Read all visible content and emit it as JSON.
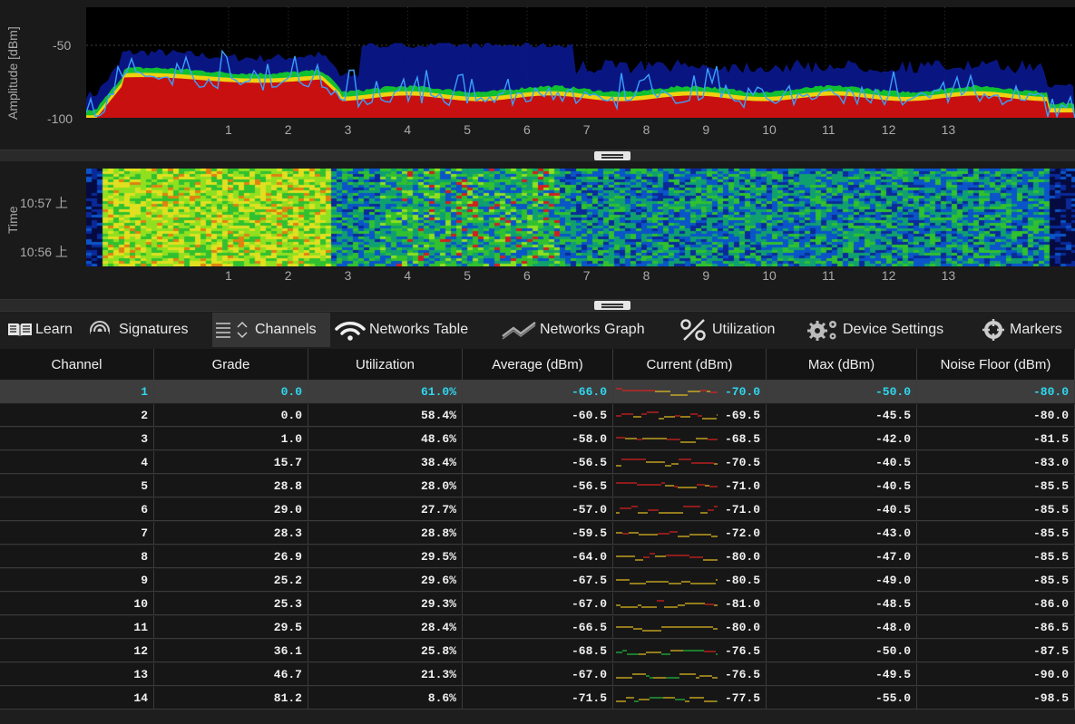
{
  "spectrum": {
    "ylabel": "Amplitude [dBm]",
    "yticks": [
      "-50",
      "-100"
    ],
    "xticks": [
      "1",
      "2",
      "3",
      "4",
      "5",
      "6",
      "7",
      "8",
      "9",
      "10",
      "11",
      "12",
      "13"
    ]
  },
  "waterfall": {
    "ylabel": "Time",
    "yticks": [
      "10:57 上",
      "10:56 上"
    ],
    "xticks": [
      "1",
      "2",
      "3",
      "4",
      "5",
      "6",
      "7",
      "8",
      "9",
      "10",
      "11",
      "12",
      "13"
    ]
  },
  "tabs": [
    {
      "label": "Learn",
      "icon": "book-icon",
      "active": false
    },
    {
      "label": "Signatures",
      "icon": "signature-icon",
      "active": false
    },
    {
      "label": "Channels",
      "icon": "channels-icon",
      "active": true
    },
    {
      "label": "Networks Table",
      "icon": "wifi-icon",
      "active": false
    },
    {
      "label": "Networks Graph",
      "icon": "graph-icon",
      "active": false
    },
    {
      "label": "Utilization",
      "icon": "percent-icon",
      "active": false
    },
    {
      "label": "Device Settings",
      "icon": "gears-icon",
      "active": false
    },
    {
      "label": "Markers",
      "icon": "crosshair-icon",
      "active": false
    }
  ],
  "table": {
    "columns": [
      "Channel",
      "Grade",
      "Utilization",
      "Average (dBm)",
      "Current (dBm)",
      "Max (dBm)",
      "Noise Floor (dBm)"
    ],
    "selected_row": 0,
    "rows": [
      [
        "1",
        "0.0",
        "61.0%",
        "-66.0",
        "-70.0",
        "-50.0",
        "-80.0"
      ],
      [
        "2",
        "0.0",
        "58.4%",
        "-60.5",
        "-69.5",
        "-45.5",
        "-80.0"
      ],
      [
        "3",
        "1.0",
        "48.6%",
        "-58.0",
        "-68.5",
        "-42.0",
        "-81.5"
      ],
      [
        "4",
        "15.7",
        "38.4%",
        "-56.5",
        "-70.5",
        "-40.5",
        "-83.0"
      ],
      [
        "5",
        "28.8",
        "28.0%",
        "-56.5",
        "-71.0",
        "-40.5",
        "-85.5"
      ],
      [
        "6",
        "29.0",
        "27.7%",
        "-57.0",
        "-71.0",
        "-40.5",
        "-85.5"
      ],
      [
        "7",
        "28.3",
        "28.8%",
        "-59.5",
        "-72.0",
        "-43.0",
        "-85.5"
      ],
      [
        "8",
        "26.9",
        "29.5%",
        "-64.0",
        "-80.0",
        "-47.0",
        "-85.5"
      ],
      [
        "9",
        "25.2",
        "29.6%",
        "-67.5",
        "-80.5",
        "-49.0",
        "-85.5"
      ],
      [
        "10",
        "25.3",
        "29.3%",
        "-67.0",
        "-81.0",
        "-48.5",
        "-86.0"
      ],
      [
        "11",
        "29.5",
        "28.4%",
        "-66.5",
        "-80.0",
        "-48.0",
        "-86.5"
      ],
      [
        "12",
        "36.1",
        "25.8%",
        "-68.5",
        "-76.5",
        "-50.0",
        "-87.5"
      ],
      [
        "13",
        "46.7",
        "21.3%",
        "-67.0",
        "-76.5",
        "-49.5",
        "-90.0"
      ],
      [
        "14",
        "81.2",
        "8.6%",
        "-71.5",
        "-77.5",
        "-55.0",
        "-98.5"
      ]
    ]
  },
  "colors": {
    "accent": "#2ed8f0",
    "trace": "#3aa0ff",
    "hot": "#c81010",
    "warm": "#f0d010",
    "cool": "#10c030",
    "floor": "#0a1890"
  }
}
